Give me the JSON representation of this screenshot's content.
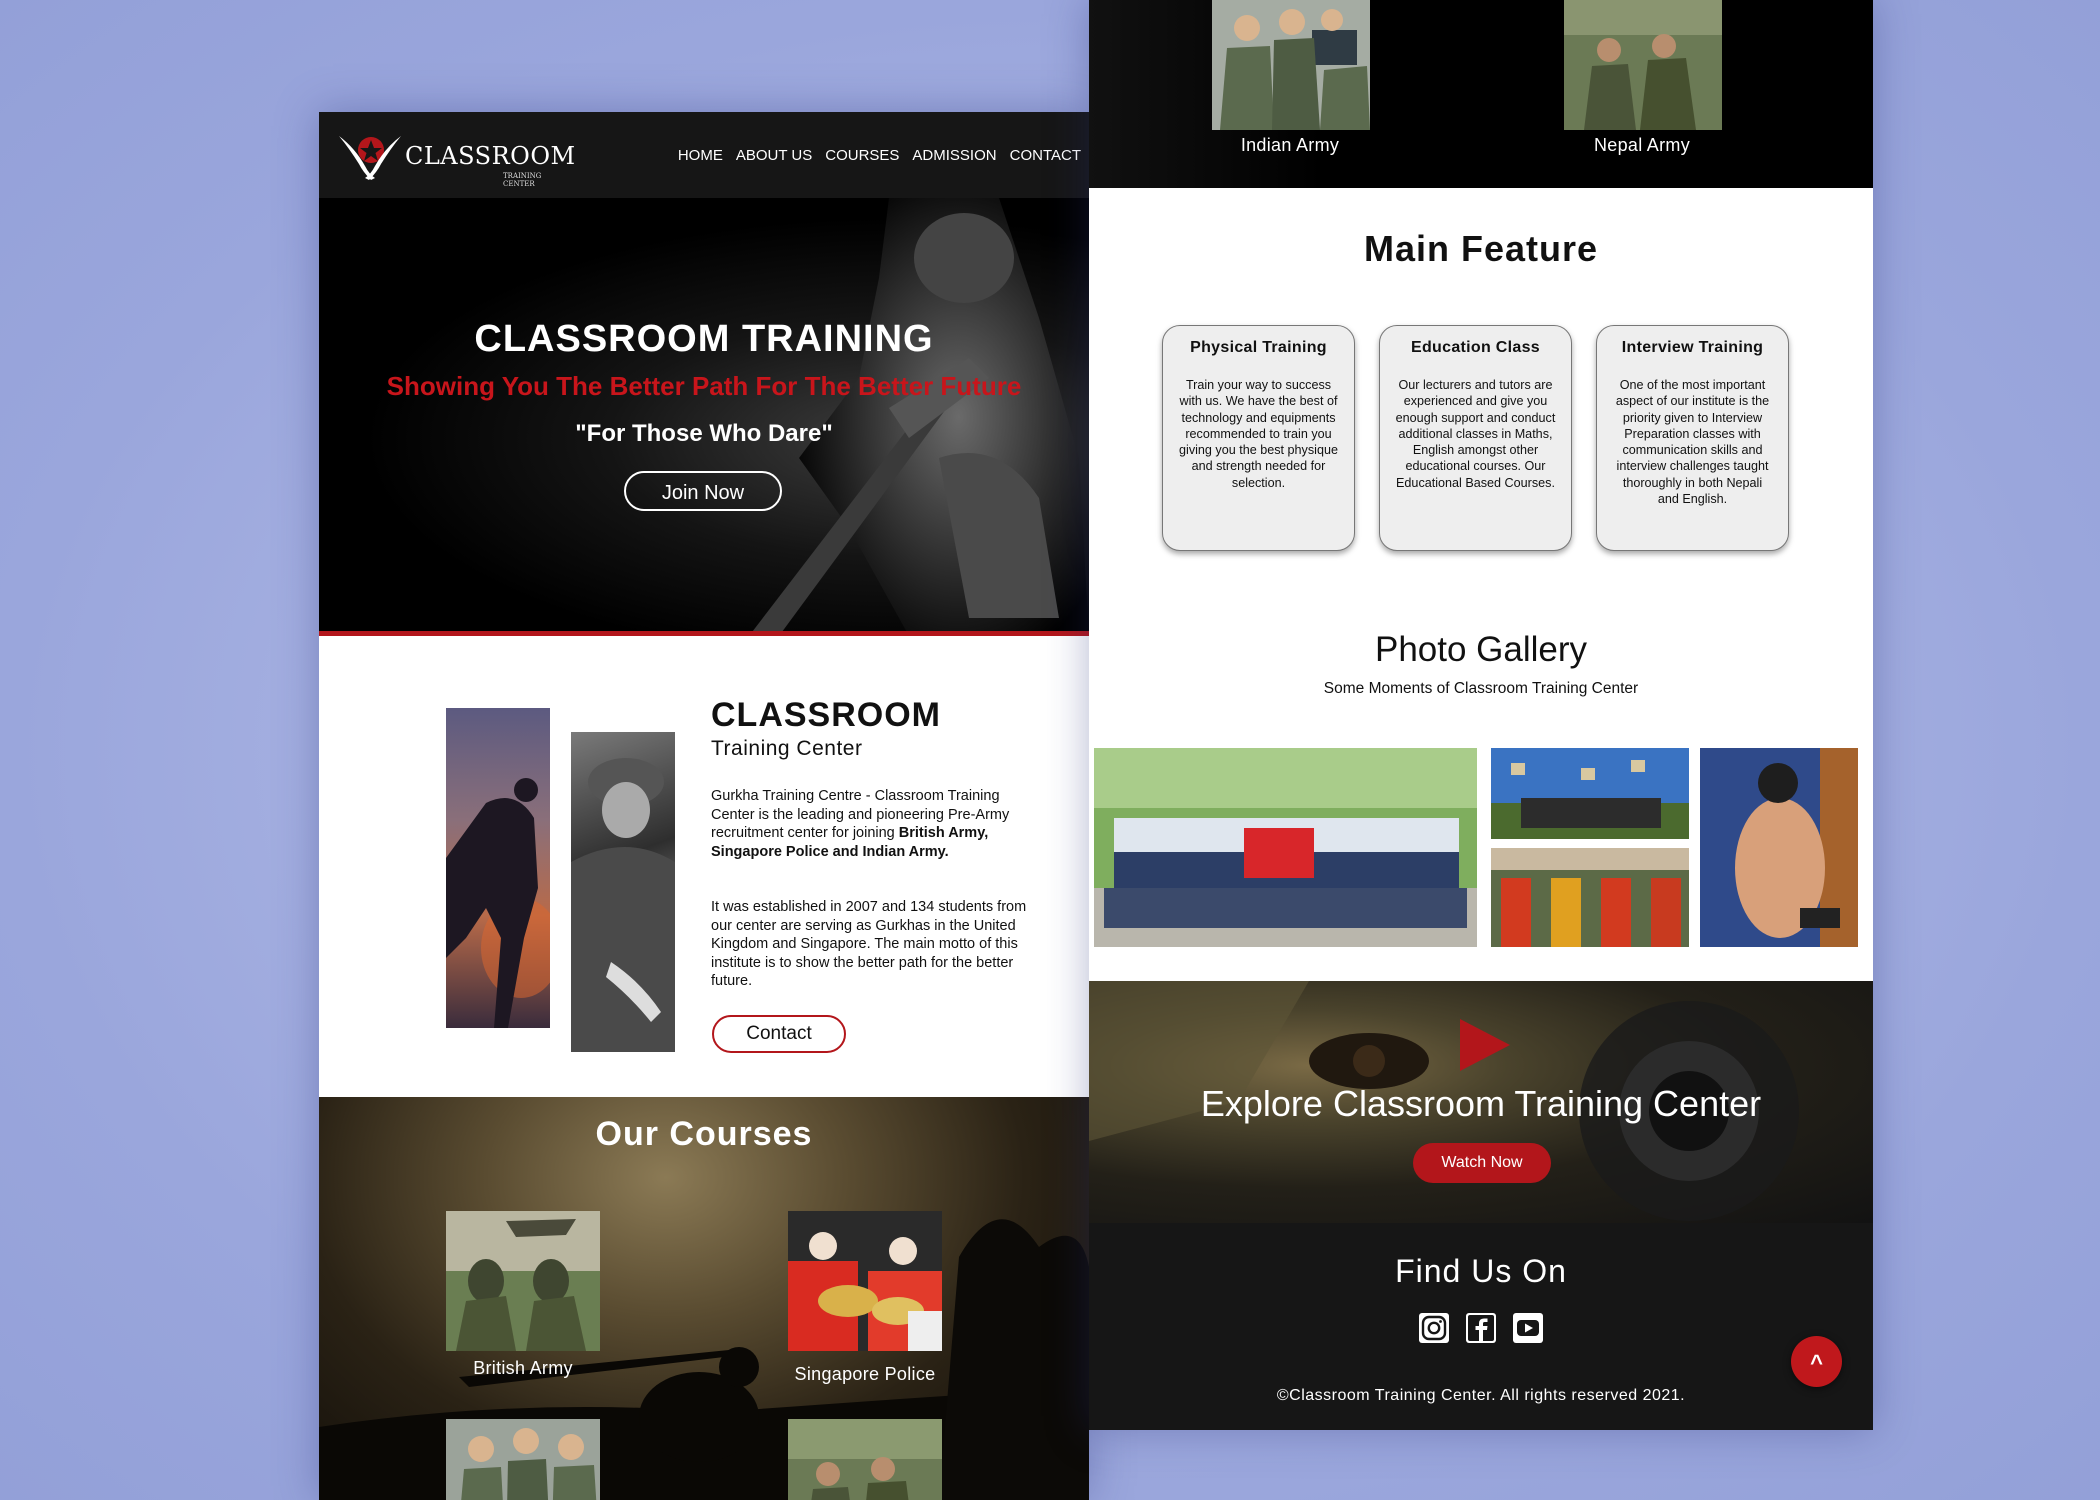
{
  "brand": {
    "name": "CLASSROOM",
    "subtitle": "TRAINING CENTER"
  },
  "nav": {
    "items": [
      "HOME",
      "ABOUT US",
      "COURSES",
      "ADMISSION",
      "CONTACT"
    ]
  },
  "hero": {
    "title": "CLASSROOM TRAINING",
    "tagline": "Showing You The Better Path For The Better Future",
    "motto": "\"For Those Who Dare\"",
    "cta": "Join Now"
  },
  "about": {
    "title": "CLASSROOM",
    "subtitle": "Training Center",
    "p1_intro": "Gurkha Training Centre - Classroom Training Center is the leading and pioneering Pre-Army recruitment center for joining ",
    "p1_bold": "British Army, Singapore Police and Indian Army.",
    "p2": "It was established in 2007 and 134 students from our center are serving as Gurkhas in the United Kingdom and Singapore. The main motto of this institute is to show the better path for the better future.",
    "cta": "Contact"
  },
  "courses": {
    "title": "Our Courses",
    "items": [
      {
        "label": "British Army"
      },
      {
        "label": "Singapore Police"
      },
      {
        "label": "Indian Army"
      },
      {
        "label": "Nepal Army"
      }
    ]
  },
  "main_feature": {
    "title": "Main Feature",
    "cards": [
      {
        "title": "Physical Training",
        "text": "Train your way to success with us. We have the best of technology and equipments recommended to train you giving you the best physique and strength needed for selection."
      },
      {
        "title": "Education Class",
        "text": "Our lecturers and tutors are experienced and give you enough support and conduct additional classes in Maths, English amongst other educational courses. Our Educational Based Courses."
      },
      {
        "title": "Interview Training",
        "text": "One of the most important aspect of our institute is the priority given to Interview Preparation classes with communication skills and interview challenges taught thoroughly in both Nepali and English."
      }
    ]
  },
  "gallery": {
    "title": "Photo Gallery",
    "subtitle": "Some Moments of Classroom Training Center"
  },
  "explore": {
    "title": "Explore Classroom Training Center",
    "cta": "Watch Now"
  },
  "footer": {
    "title": "Find Us On",
    "icons": [
      "instagram-icon",
      "facebook-icon",
      "youtube-icon"
    ],
    "copyright": "©Classroom Training Center. All rights reserved 2021.",
    "to_top": "^"
  },
  "colors": {
    "accent": "#b3161b",
    "dark": "#161616",
    "background": "#a6b0e0"
  }
}
